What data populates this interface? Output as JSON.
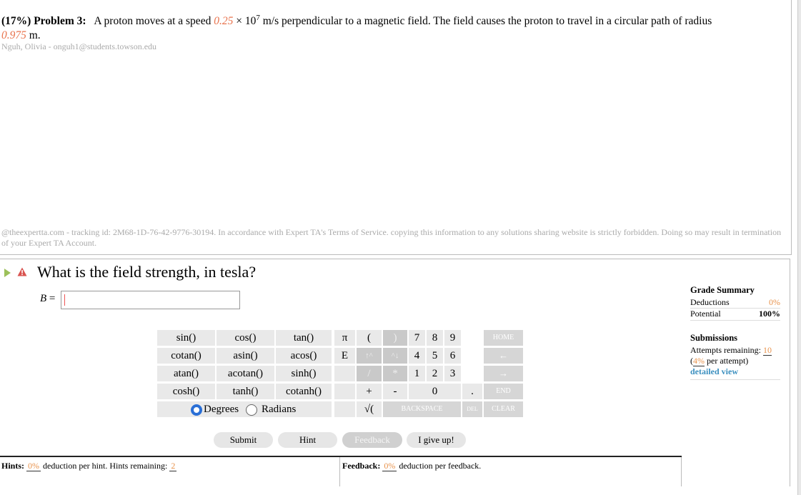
{
  "problem": {
    "weight": "(17%)",
    "label": "Problem 3:",
    "text_1": "A proton moves at a speed ",
    "speed": "0.25",
    "times": " × 10",
    "exp": "7",
    "text_2": " m/s perpendicular to a magnetic field. The field causes the proton to travel in a circular path of radius",
    "radius": "0.975",
    "text_3": " m.",
    "student": "Nguh, Olivia - onguh1@students.towson.edu",
    "tracking": "@theexpertta.com - tracking id: 2M68-1D-76-42-9776-30194. In accordance with Expert TA's Terms of Service. copying this information to any solutions sharing website is strictly forbidden. Doing so may result in termination of your Expert TA Account."
  },
  "question": {
    "text": "What is the field strength, in tesla?",
    "var": "B",
    "eq": " =",
    "value": ""
  },
  "keypad": {
    "sin": "sin()",
    "cos": "cos()",
    "tan": "tan()",
    "cotan": "cotan()",
    "asin": "asin()",
    "acos": "acos()",
    "atan": "atan()",
    "acotan": "acotan()",
    "sinh": "sinh()",
    "cosh": "cosh()",
    "tanh": "tanh()",
    "cotanh": "cotanh()",
    "pi": "π",
    "e": "E",
    "lparen": "(",
    "rparen": ")",
    "up": "↑^",
    "down": "^↓",
    "slash": "/",
    "star": "*",
    "plus": "+",
    "minus": "-",
    "sqrt": "√(",
    "k7": "7",
    "k8": "8",
    "k9": "9",
    "k4": "4",
    "k5": "5",
    "k6": "6",
    "k1": "1",
    "k2": "2",
    "k3": "3",
    "k0": "0",
    "dot": ".",
    "home": "HOME",
    "left": "←",
    "right": "→",
    "end": "END",
    "backspace": "BACKSPACE",
    "del": "DEL",
    "clear": "CLEAR",
    "degrees": "Degrees",
    "radians": "Radians"
  },
  "buttons": {
    "submit": "Submit",
    "hint": "Hint",
    "feedback": "Feedback",
    "giveup": "I give up!"
  },
  "hints": {
    "label": "Hints:",
    "pct": "0%",
    "text": " deduction per hint. Hints remaining: ",
    "remaining": "2"
  },
  "feedback": {
    "label": "Feedback:",
    "pct": "0%",
    "text": " deduction per feedback."
  },
  "grade_summary": {
    "title": "Grade Summary",
    "deductions_label": "Deductions",
    "deductions_value": "0%",
    "potential_label": "Potential",
    "potential_value": "100%"
  },
  "submissions": {
    "title": "Submissions",
    "attempts_label": "Attempts remaining: ",
    "attempts_value": "10",
    "per_attempt_open": "(",
    "per_attempt_pct": "4%",
    "per_attempt_text": " per attempt)",
    "detailed": "detailed view"
  }
}
